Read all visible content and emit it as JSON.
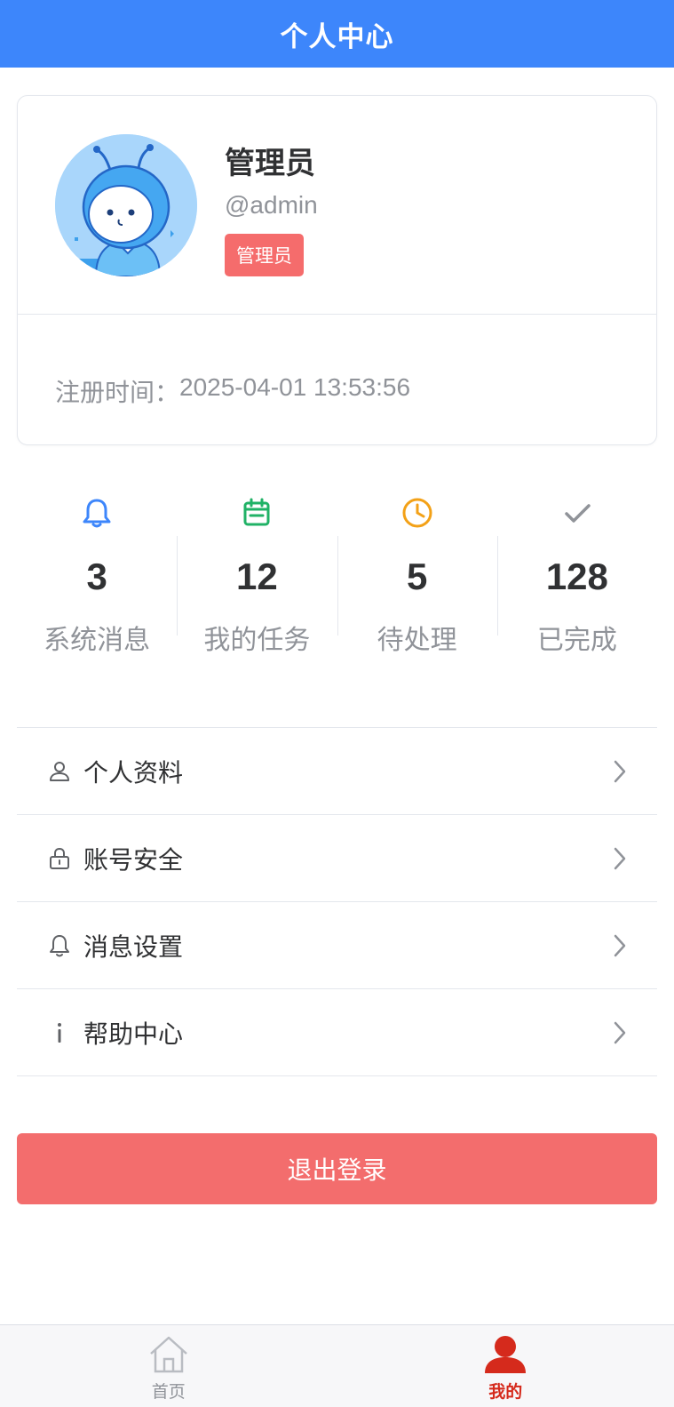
{
  "header": {
    "title": "个人中心"
  },
  "profile": {
    "name": "管理员",
    "handle": "@admin",
    "role_badge": "管理员",
    "register_label": "注册时间：",
    "register_time": "2025-04-01 13:53:56"
  },
  "stats": [
    {
      "icon": "bell-icon",
      "value": "3",
      "label": "系统消息",
      "color": "#3d86fb"
    },
    {
      "icon": "calendar-icon",
      "value": "12",
      "label": "我的任务",
      "color": "#20b266"
    },
    {
      "icon": "clock-icon",
      "value": "5",
      "label": "待处理",
      "color": "#f3a117"
    },
    {
      "icon": "check-icon",
      "value": "128",
      "label": "已完成",
      "color": "#909399"
    }
  ],
  "menu": [
    {
      "icon": "user-icon",
      "label": "个人资料"
    },
    {
      "icon": "lock-icon",
      "label": "账号安全"
    },
    {
      "icon": "bell-icon",
      "label": "消息设置"
    },
    {
      "icon": "info-icon",
      "label": "帮助中心"
    }
  ],
  "logout_label": "退出登录",
  "tabbar": [
    {
      "icon": "home-icon",
      "label": "首页"
    },
    {
      "icon": "person-icon",
      "label": "我的",
      "active": true
    }
  ],
  "colors": {
    "primary": "#3d86fb",
    "danger": "#f56c6c",
    "tab_active": "#d52a1c"
  }
}
